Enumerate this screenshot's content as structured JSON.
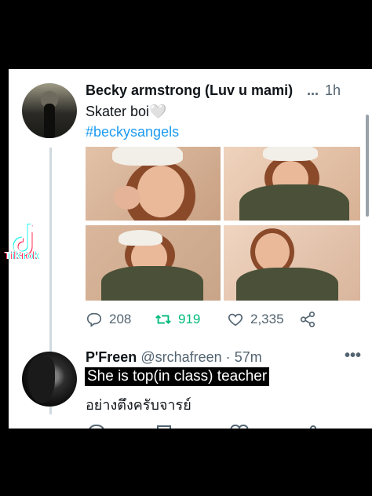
{
  "tweet": {
    "author_name": "Becky armstrong (Luv u mami)",
    "more": "...",
    "time_separator": "·",
    "time": "1h",
    "text": "Skater boi",
    "emoji": "🤍",
    "hashtag": "#beckysangels",
    "stats": {
      "replies": "208",
      "retweets": "919",
      "likes": "2,335"
    }
  },
  "reply": {
    "author_name": "P'Freen",
    "handle": "@srchafreen",
    "time_separator": "·",
    "time": "57m",
    "more": "•••",
    "caption": "She is top(in class) teacher",
    "thai_text": "อย่างตึงครับจารย์"
  },
  "watermark": {
    "text": "TikTok"
  },
  "colors": {
    "accent": "#1d9bf0",
    "retweet": "#00ba7c",
    "muted": "#536471"
  },
  "icons": [
    "reply-icon",
    "retweet-icon",
    "like-icon",
    "share-icon",
    "tiktok-logo-icon"
  ]
}
